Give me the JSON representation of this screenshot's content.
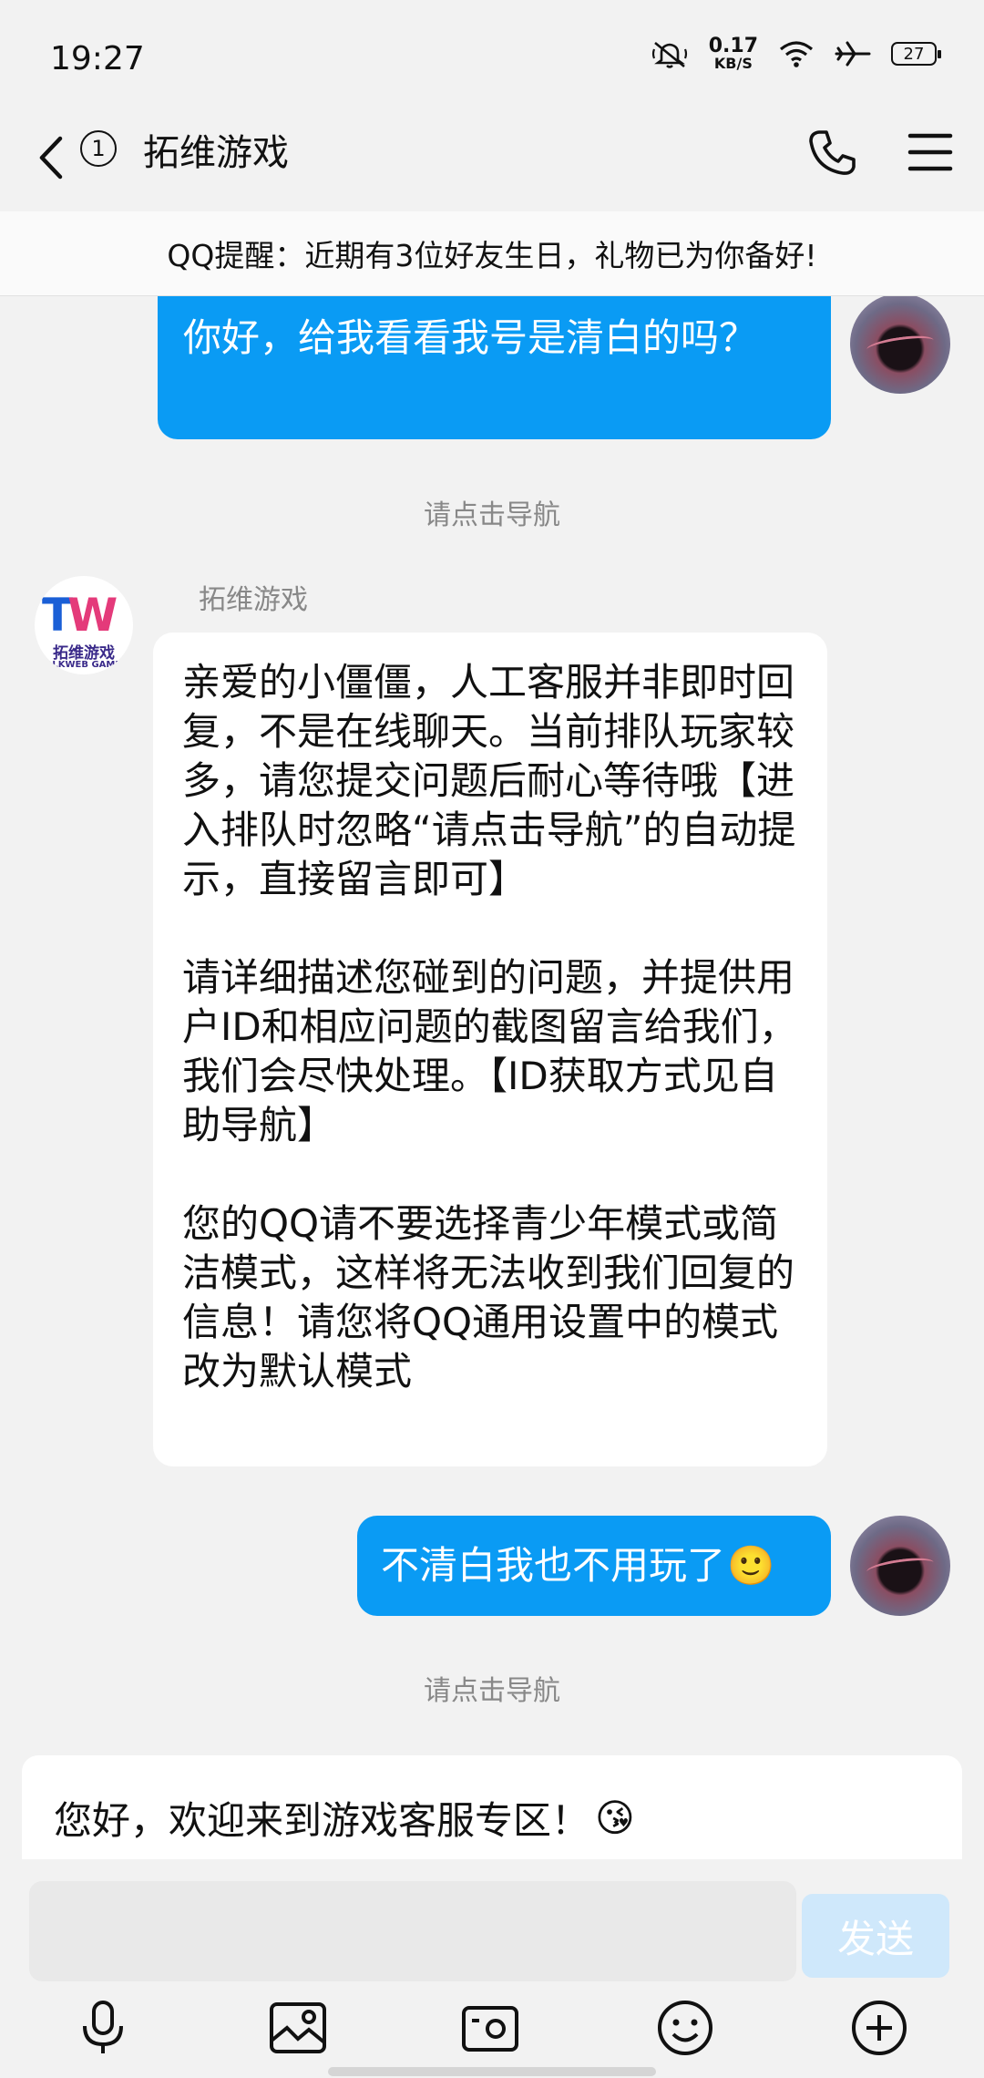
{
  "status_bar": {
    "time": "19:27",
    "net_speed_value": "0.17",
    "net_speed_unit": "KB/S",
    "battery": "27"
  },
  "header": {
    "unread_count": "1",
    "title": "拓维游戏"
  },
  "notice": "QQ提醒：近期有3位好友生日，礼物已为你备好!",
  "messages": [
    {
      "side": "right",
      "text": "你好，给我看看我号是清白的吗？"
    },
    {
      "side": "center",
      "text": "请点击导航"
    },
    {
      "side": "left",
      "sender": "拓维游戏",
      "avatar_text": "拓维游戏",
      "avatar_sub": "TALKWEB GAMES",
      "paragraphs": [
        "亲爱的小僵僵，人工客服并非即时回复，不是在线聊天。当前排队玩家较多，请您提交问题后耐心等待哦【进入排队时忽略“请点击导航”的自动提示，直接留言即可】",
        "请详细描述您碰到的问题，并提供用户ID和相应问题的截图留言给我们，我们会尽快处理。【ID获取方式见自助导航】",
        "您的QQ请不要选择青少年模式或简洁模式，这样将无法收到我们回复的信息！请您将QQ通用设置中的模式改为默认模式"
      ]
    },
    {
      "side": "right",
      "text": "不清白我也不用玩了",
      "emoji": "🙂"
    },
    {
      "side": "center",
      "text": "请点击导航"
    }
  ],
  "preview": {
    "text": "您好，欢迎来到游戏客服专区！",
    "emoji": "😘"
  },
  "input": {
    "value": "",
    "send_label": "发送"
  },
  "toolbar": [
    "mic-icon",
    "image-icon",
    "camera-icon",
    "emoji-icon",
    "plus-icon"
  ],
  "colors": {
    "bubble_blue": "#0a9bf4",
    "send_disabled": "#cfe8fb"
  }
}
